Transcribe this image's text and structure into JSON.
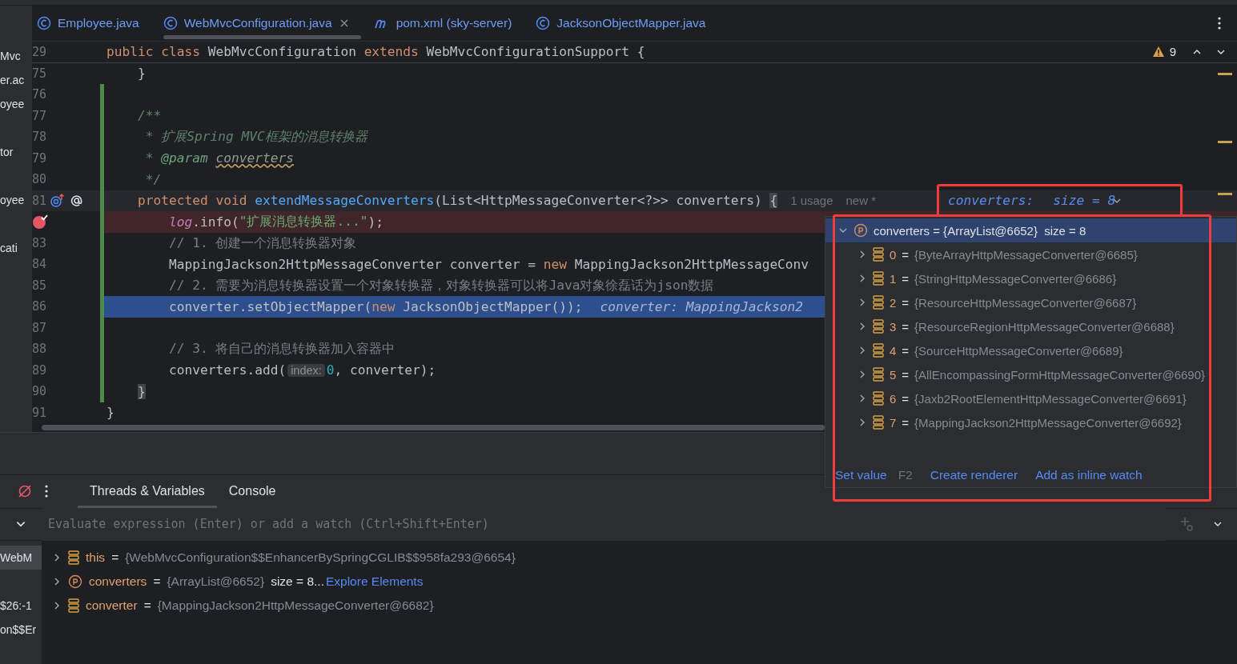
{
  "sidebar_fragments": [
    "Mvc",
    "er.ac",
    "oyee",
    "tor",
    "oyee",
    "cati"
  ],
  "tabs": [
    {
      "label": "Employee.java",
      "kind": "class",
      "selected": false
    },
    {
      "label": "WebMvcConfiguration.java",
      "kind": "class",
      "selected": true
    },
    {
      "label": "pom.xml (sky-server)",
      "kind": "maven",
      "selected": false
    },
    {
      "label": "JacksonObjectMapper.java",
      "kind": "class",
      "selected": false
    }
  ],
  "editor": {
    "sticky_line": {
      "number": "29",
      "tokens": [
        {
          "kind": "kw",
          "text": "public class "
        },
        {
          "kind": "plain",
          "text": "WebMvcConfiguration "
        },
        {
          "kind": "kw",
          "text": "extends "
        },
        {
          "kind": "plain",
          "text": "WebMvcConfigurationSupport {"
        }
      ]
    },
    "warnings": "9",
    "lines": [
      {
        "number": "75",
        "changed": false,
        "tokens": [
          {
            "kind": "plain",
            "text": "}"
          }
        ]
      },
      {
        "number": "76",
        "changed": true
      },
      {
        "number": "77",
        "changed": true,
        "tokens": [
          {
            "kind": "doc",
            "text": "/**"
          }
        ]
      },
      {
        "number": "78",
        "changed": true,
        "tokens": [
          {
            "kind": "doc",
            "text": " * 扩展Spring MVC框架的消息转换器"
          }
        ]
      },
      {
        "number": "79",
        "changed": true,
        "tokens": [
          {
            "kind": "doc",
            "text": " * "
          },
          {
            "kind": "doctag",
            "text": "@param"
          },
          {
            "kind": "docref",
            "text": "converters"
          }
        ]
      },
      {
        "number": "80",
        "changed": true,
        "tokens": [
          {
            "kind": "doc",
            "text": " */"
          }
        ]
      },
      {
        "number": "81",
        "kind": "caret",
        "changed": true,
        "gutter": [
          {
            "kind": "override"
          },
          {
            "kind": "implements"
          }
        ],
        "expandable": true,
        "tokens": [
          {
            "kind": "kw",
            "text": "protected void "
          },
          {
            "kind": "func",
            "text": "extendMessageConverters"
          },
          {
            "kind": "plain",
            "text": "(List<HttpMessageConverter<?>> converters) "
          },
          {
            "kind": "brace",
            "text": "{"
          },
          {
            "kind": "hint",
            "text": "1 usage"
          },
          {
            "kind": "hint",
            "text": "new *"
          },
          {
            "kind": "debug",
            "text": "converters:"
          },
          {
            "kind": "debug",
            "text": "size = 8"
          }
        ],
        "children": [
          {
            "kind": "breakpoint",
            "changed": true,
            "gutter": [
              {
                "kind": "breakpoint"
              }
            ],
            "tokens": [
              {
                "kind": "field",
                "text": "log"
              },
              {
                "kind": "plain",
                "text": ".info("
              },
              {
                "kind": "string",
                "text": "\"扩展消息转换器...\""
              },
              {
                "kind": "plain",
                "text": ");"
              }
            ]
          },
          {
            "number": "83",
            "changed": true,
            "tokens": [
              {
                "kind": "comment",
                "text": "// 1. 创建一个消息转换器对象"
              }
            ]
          },
          {
            "number": "84",
            "changed": true,
            "tokens": [
              {
                "kind": "plain",
                "text": "MappingJackson2HttpMessageConverter converter = "
              },
              {
                "kind": "kw",
                "text": "new "
              },
              {
                "kind": "plain",
                "text": "MappingJackson2HttpMessageConv"
              }
            ]
          },
          {
            "number": "85",
            "changed": true,
            "tokens": [
              {
                "kind": "comment",
                "text": "// 2. 需要为消息转换器设置一个对象转换器，对象转换器可以将Java对象徐磊话为json数据"
              }
            ]
          },
          {
            "number": "86",
            "kind": "execution",
            "changed": true,
            "tokens": [
              {
                "kind": "plain",
                "text": "converter.setObjectMapper("
              },
              {
                "kind": "kw",
                "text": "new "
              },
              {
                "kind": "plain",
                "text": "JacksonObjectMapper());"
              },
              {
                "kind": "debugvalue",
                "text": "converter: MappingJackson2"
              }
            ]
          },
          {
            "number": "87",
            "changed": true
          },
          {
            "number": "88",
            "changed": true,
            "tokens": [
              {
                "kind": "comment",
                "text": "// 3. 将自己的消息转换器加入容器中"
              }
            ]
          },
          {
            "number": "89",
            "changed": true,
            "tokens": [
              {
                "kind": "plain",
                "text": "converters.add("
              },
              {
                "kind": "paramhint",
                "text": "index:"
              },
              {
                "kind": "number",
                "text": "0"
              },
              {
                "kind": "plain",
                "text": ", converter);"
              }
            ]
          }
        ]
      },
      {
        "number": "90",
        "changed": true,
        "tokens": [
          {
            "kind": "brace",
            "text": "}"
          }
        ]
      }
    ],
    "closing_line": {
      "number": "91",
      "changed": false,
      "tokens": [
        {
          "kind": "plain",
          "text": "}"
        }
      ]
    }
  },
  "popup": {
    "header": {
      "kind": "param",
      "text": "converters = {ArrayList@6652}  size = 8",
      "expanded": true,
      "selected": true
    },
    "items": [
      {
        "kind": "field",
        "name": "0",
        "sep": "=",
        "value": "{ByteArrayHttpMessageConverter@6685}",
        "expanded": false
      },
      {
        "kind": "field",
        "name": "1",
        "sep": "=",
        "value": "{StringHttpMessageConverter@6686}",
        "expanded": false
      },
      {
        "kind": "field",
        "name": "2",
        "sep": "=",
        "value": "{ResourceHttpMessageConverter@6687}",
        "expanded": false
      },
      {
        "kind": "field",
        "name": "3",
        "sep": "=",
        "value": "{ResourceRegionHttpMessageConverter@6688}",
        "expanded": false
      },
      {
        "kind": "field",
        "name": "4",
        "sep": "=",
        "value": "{SourceHttpMessageConverter@6689}",
        "expanded": false
      },
      {
        "kind": "field",
        "name": "5",
        "sep": "=",
        "value": "{AllEncompassingFormHttpMessageConverter@6690}",
        "expanded": false
      },
      {
        "kind": "field",
        "name": "6",
        "sep": "=",
        "value": "{Jaxb2RootElementHttpMessageConverter@6691}",
        "expanded": false
      },
      {
        "kind": "field",
        "name": "7",
        "sep": "=",
        "value": "{MappingJackson2HttpMessageConverter@6692}",
        "expanded": false
      }
    ],
    "actions": [
      {
        "label": "Set value",
        "shortcut": "F2"
      },
      {
        "label": "Create renderer"
      },
      {
        "label": "Add as inline watch"
      }
    ]
  },
  "debug": {
    "tabs": [
      {
        "label": "Threads & Variables",
        "selected": true
      },
      {
        "label": "Console",
        "selected": false
      }
    ],
    "evaluate_placeholder": "Evaluate expression (Enter) or add a watch (Ctrl+Shift+Enter)",
    "frames": [
      {
        "text": "WebM",
        "selected": true
      },
      {
        "text": "$26:-1",
        "selected": false
      },
      {
        "text": "on$$Er",
        "selected": false
      }
    ],
    "variables": [
      {
        "kind": "field",
        "name": "this",
        "sep": "=",
        "value": "{WebMvcConfiguration$$EnhancerBySpringCGLIB$$958fa293@6654}",
        "expanded": false
      },
      {
        "kind": "param",
        "name": "converters",
        "sep": "=",
        "value": "{ArrayList@6652}",
        "extra": "size = 8...",
        "link": "Explore Elements",
        "expanded": false
      },
      {
        "kind": "field",
        "name": "converter",
        "sep": "=",
        "value": "{MappingJackson2HttpMessageConverter@6682}",
        "expanded": false
      }
    ]
  }
}
